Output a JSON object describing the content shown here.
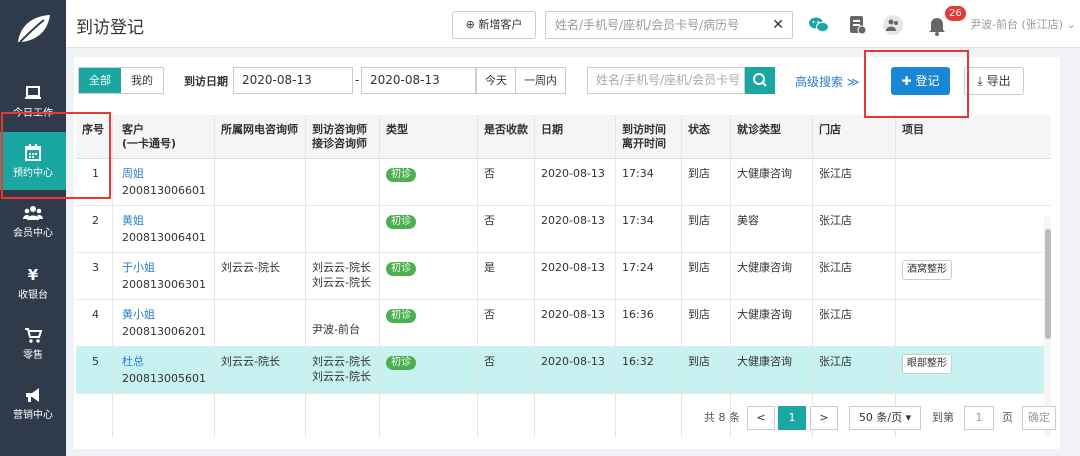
{
  "app": {
    "title": "到访登记"
  },
  "header": {
    "new_customer_label": "新增客户",
    "search_placeholder": "姓名/手机号/座机/会员卡号/病历号",
    "notification_count": "26",
    "user": "尹波-前台 (张江店)"
  },
  "sidebar": {
    "items": [
      {
        "label": "今日工作",
        "icon": "laptop-icon"
      },
      {
        "label": "预约中心",
        "icon": "calendar-icon"
      },
      {
        "label": "会员中心",
        "icon": "users-icon"
      },
      {
        "label": "收银台",
        "icon": "yen-icon"
      },
      {
        "label": "零售",
        "icon": "cart-icon"
      },
      {
        "label": "营销中心",
        "icon": "megaphone-icon"
      }
    ]
  },
  "filters": {
    "tab_all": "全部",
    "tab_mine": "我的",
    "date_label": "到访日期",
    "date_from": "2020-08-13",
    "date_sep": "-",
    "date_to": "2020-08-13",
    "today": "今天",
    "week": "一周内",
    "search_placeholder": "姓名/手机号/座机/会员卡号",
    "advanced": "高级搜索",
    "register": "登记",
    "export": "导出"
  },
  "table": {
    "headers": [
      "序号",
      "客户\n(一卡通号)",
      "所属网电咨询师",
      "到访咨询师\n接诊咨询师",
      "类型",
      "是否收款",
      "日期",
      "到访时间\n离开时间",
      "状态",
      "就诊类型",
      "门店",
      "项目"
    ],
    "rows": [
      {
        "no": "1",
        "name": "周姐",
        "card": "200813006601",
        "net": "",
        "visit1": "",
        "visit2": "",
        "type": "初诊",
        "paid": "否",
        "date": "2020-08-13",
        "time": "17:34",
        "status": "到店",
        "vtype": "大健康咨询",
        "store": "张江店",
        "project": ""
      },
      {
        "no": "2",
        "name": "黄姐",
        "card": "200813006401",
        "net": "",
        "visit1": "",
        "visit2": "",
        "type": "初诊",
        "paid": "否",
        "date": "2020-08-13",
        "time": "17:34",
        "status": "到店",
        "vtype": "美容",
        "store": "张江店",
        "project": ""
      },
      {
        "no": "3",
        "name": "于小姐",
        "card": "200813006301",
        "net": "刘云云-院长",
        "visit1": "刘云云-院长",
        "visit2": "刘云云-院长",
        "type": "初诊",
        "paid": "是",
        "date": "2020-08-13",
        "time": "17:24",
        "status": "到店",
        "vtype": "大健康咨询",
        "store": "张江店",
        "project": "酒窝整形"
      },
      {
        "no": "4",
        "name": "黄小姐",
        "card": "200813006201",
        "net": "",
        "visit1": "",
        "visit2": "尹波-前台",
        "type": "初诊",
        "paid": "否",
        "date": "2020-08-13",
        "time": "16:36",
        "status": "到店",
        "vtype": "大健康咨询",
        "store": "张江店",
        "project": ""
      },
      {
        "no": "5",
        "name": "杜总",
        "card": "200813005601",
        "net": "刘云云-院长",
        "visit1": "刘云云-院长",
        "visit2": "刘云云-院长",
        "type": "初诊",
        "paid": "否",
        "date": "2020-08-13",
        "time": "16:32",
        "status": "到店",
        "vtype": "大健康咨询",
        "store": "张江店",
        "project": "眼部整形"
      }
    ]
  },
  "pagination": {
    "total": "共 8 条",
    "prev": "<",
    "current": "1",
    "next": ">",
    "page_size": "50 条/页",
    "goto_label": "到第",
    "goto_value": "1",
    "page_unit": "页",
    "confirm": "确定"
  },
  "colors": {
    "accent": "#1aa7a2",
    "primary_button": "#1a87d4",
    "highlight": "#e53935"
  }
}
